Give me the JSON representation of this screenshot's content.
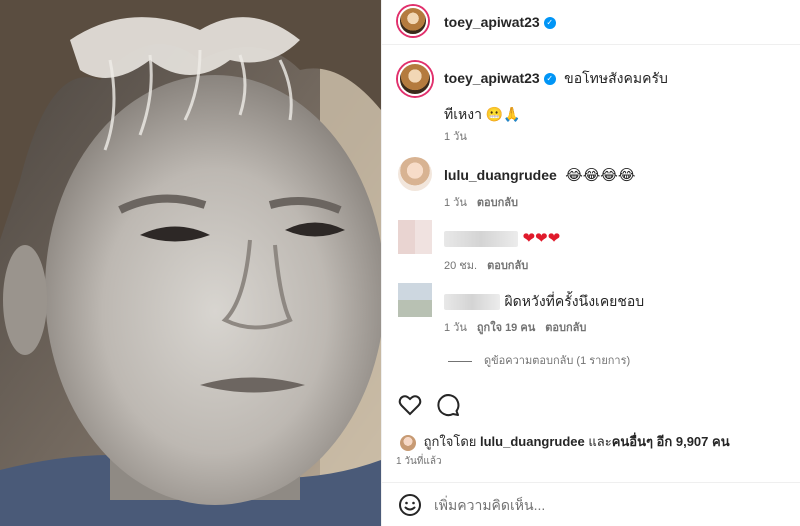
{
  "post": {
    "author": "toey_apiwat23",
    "verified": true
  },
  "caption": {
    "author": "toey_apiwat23",
    "text_inline": "ขอโทษสังคมครับ",
    "text_line2": "ทีเหงา 😬🙏",
    "time": "1 วัน"
  },
  "comments": [
    {
      "author": "lulu_duangrudee",
      "text": "😂😂😂😂",
      "time": "1 วัน",
      "reply_label": "ตอบกลับ"
    },
    {
      "author": "",
      "text": "❤❤❤",
      "time": "20 ชม.",
      "reply_label": "ตอบกลับ"
    },
    {
      "author": "",
      "text": "ผิดหวังที่ครั้งนึงเคยชอบ",
      "time": "1 วัน",
      "likes": "ถูกใจ 19 คน",
      "reply_label": "ตอบกลับ",
      "view_replies": "ดูข้อความตอบกลับ (1 รายการ)"
    }
  ],
  "likes": {
    "prefix": "ถูกใจโดย",
    "first_user": "lulu_duangrudee",
    "and_text": "และ",
    "others": "คนอื่นๆ อีก 9,907 คน"
  },
  "posted_time": "1 วันที่แล้ว",
  "add_comment": {
    "placeholder": "เพิ่มความคิดเห็น..."
  },
  "icons": {
    "like": "heart-outline-icon",
    "comment": "speech-bubble-icon",
    "emoji": "smiley-icon",
    "verified": "verified-badge-icon"
  },
  "colors": {
    "verified": "#0095f6",
    "heart": "#e01a2b",
    "story_ring": "#e1306c"
  }
}
